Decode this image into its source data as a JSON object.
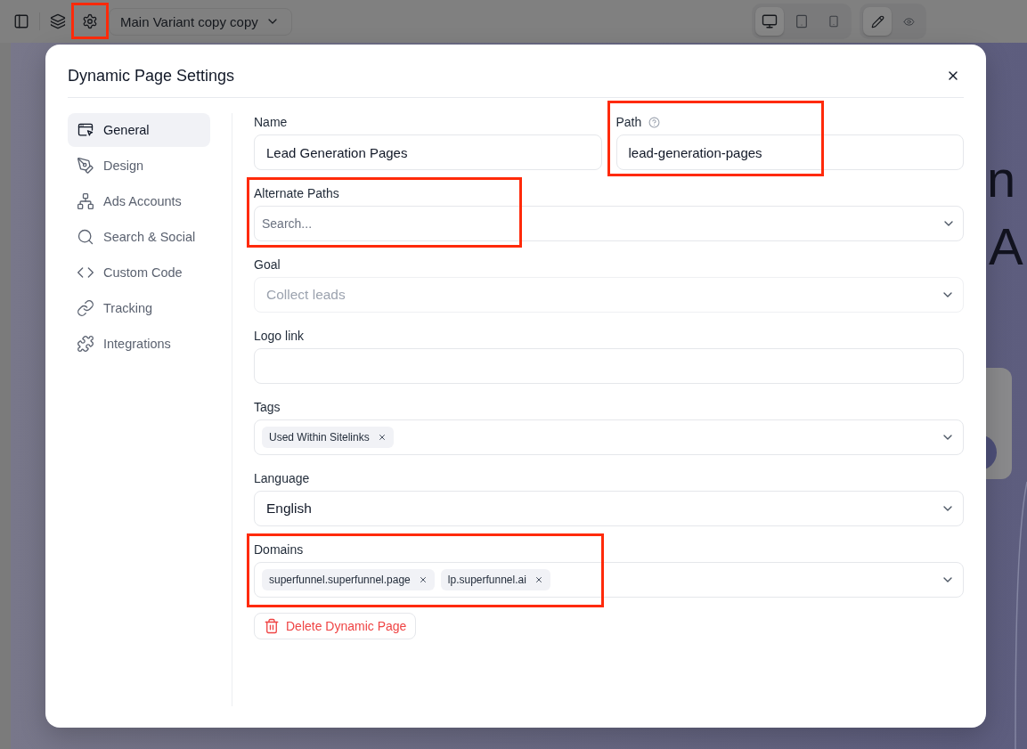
{
  "toolbar": {
    "variant": "Main Variant copy copy",
    "settings_highlighted": true,
    "devices": [
      {
        "selected": true
      },
      {
        "selected": false
      },
      {
        "selected": false
      }
    ],
    "modes": [
      {
        "selected": true
      },
      {
        "selected": false
      }
    ]
  },
  "canvas": {
    "heading_fragment": "n",
    "second_line_fragment": "A"
  },
  "dialog": {
    "title": "Dynamic Page Settings",
    "sidebar": {
      "items": [
        {
          "label": "General",
          "selected": true
        },
        {
          "label": "Design",
          "selected": false
        },
        {
          "label": "Ads Accounts",
          "selected": false
        },
        {
          "label": "Search & Social",
          "selected": false
        },
        {
          "label": "Custom Code",
          "selected": false
        },
        {
          "label": "Tracking",
          "selected": false
        },
        {
          "label": "Integrations",
          "selected": false
        }
      ]
    },
    "form": {
      "rows": [
        [
          {
            "kind": "text",
            "label": "Name",
            "value": "Lead Generation Pages",
            "help": false,
            "highlighted": false
          },
          {
            "kind": "text",
            "label": "Path",
            "value": "lead-generation-pages",
            "help": true,
            "highlighted": true
          }
        ],
        [
          {
            "kind": "combobox",
            "label": "Alternate Paths",
            "placeholder": "Search...",
            "help": false,
            "highlighted": true
          }
        ],
        [
          {
            "kind": "select",
            "label": "Goal",
            "placeholder": "Collect leads",
            "help": false,
            "highlighted": false
          }
        ],
        [
          {
            "kind": "text",
            "label": "Logo link",
            "help": false,
            "highlighted": false
          }
        ],
        [
          {
            "kind": "tags",
            "label": "Tags",
            "chips": [
              "Used Within Sitelinks"
            ],
            "help": false,
            "highlighted": false
          }
        ],
        [
          {
            "kind": "select",
            "label": "Language",
            "value": "English",
            "help": false,
            "highlighted": false
          }
        ],
        [
          {
            "kind": "tags",
            "label": "Domains",
            "chips": [
              "superfunnel.superfunnel.page",
              "lp.superfunnel.ai"
            ],
            "help": false,
            "highlighted": true
          }
        ]
      ],
      "delete_button": "Delete Dynamic Page"
    }
  }
}
